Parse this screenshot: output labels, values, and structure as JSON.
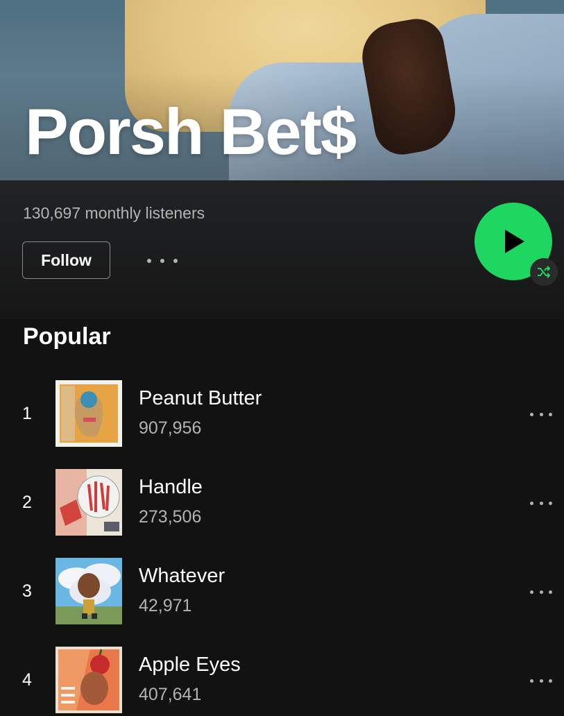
{
  "artist": {
    "name": "Porsh Bet$",
    "monthly_listeners": "130,697 monthly listeners"
  },
  "actions": {
    "follow_label": "Follow"
  },
  "popular": {
    "title": "Popular",
    "tracks": [
      {
        "rank": "1",
        "title": "Peanut Butter",
        "plays": "907,956"
      },
      {
        "rank": "2",
        "title": "Handle",
        "plays": "273,506"
      },
      {
        "rank": "3",
        "title": "Whatever",
        "plays": "42,971"
      },
      {
        "rank": "4",
        "title": "Apple Eyes",
        "plays": "407,641"
      }
    ]
  },
  "icons": {
    "play": "play-icon",
    "shuffle": "shuffle-icon",
    "more": "more-icon"
  },
  "colors": {
    "background": "#121212",
    "accent": "#1ed760",
    "secondary_text": "#b3b3b3"
  }
}
